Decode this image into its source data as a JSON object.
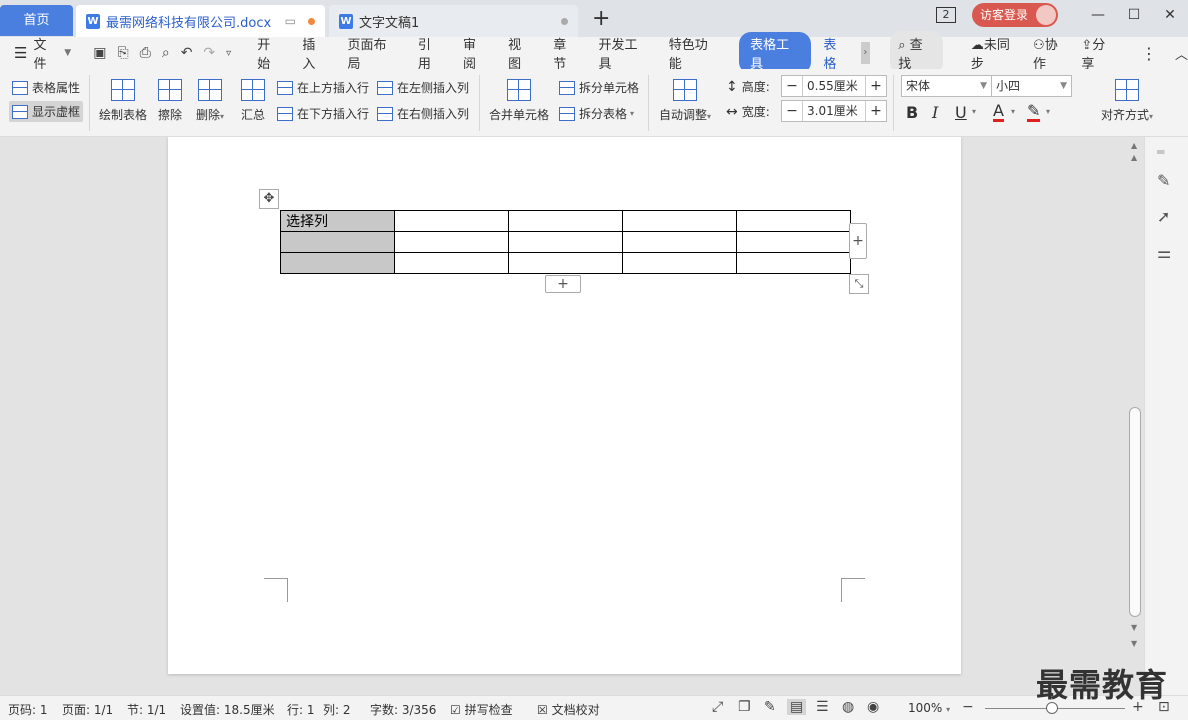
{
  "tabs": {
    "home": "首页",
    "active_doc": "最需网络科技有限公司.docx",
    "second_doc": "文字文稿1",
    "new_tab": "+"
  },
  "titlebar": {
    "badge": "2",
    "login": "访客登录",
    "minimize": "—",
    "maximize": "☐",
    "close": "✕"
  },
  "menubar": {
    "file": "文件",
    "items": [
      "开始",
      "插入",
      "页面布局",
      "引用",
      "审阅",
      "视图",
      "章节",
      "开发工具",
      "特色功能"
    ],
    "active": "表格工具",
    "next": "表格",
    "search": "查找",
    "sync": "未同步",
    "collab": "协作",
    "share": "分享"
  },
  "ribbon": {
    "table_props": "表格属性",
    "show_grid": "显示虚框",
    "draw_table": "绘制表格",
    "erase": "擦除",
    "delete": "删除",
    "summary": "汇总",
    "insert_above": "在上方插入行",
    "insert_below": "在下方插入行",
    "insert_left": "在左侧插入列",
    "insert_right": "在右侧插入列",
    "merge_cells": "合并单元格",
    "split_cells": "拆分单元格",
    "split_table": "拆分表格",
    "auto_adjust": "自动调整",
    "height_label": "高度:",
    "height_value": "0.55厘米",
    "width_label": "宽度:",
    "width_value": "3.01厘米",
    "font_name": "宋体",
    "font_size": "小四",
    "align": "对齐方式"
  },
  "document": {
    "table_rows": [
      [
        "选择列",
        "",
        "",
        "",
        ""
      ],
      [
        "",
        "",
        "",
        "",
        ""
      ],
      [
        "",
        "",
        "",
        "",
        ""
      ]
    ]
  },
  "statusbar": {
    "page_num": "页码: 1",
    "pages": "页面: 1/1",
    "section": "节: 1/1",
    "setting": "设置值: 18.5厘米",
    "row": "行: 1",
    "col": "列: 2",
    "words": "字数: 3/356",
    "spell": "拼写检查",
    "proof": "文档校对",
    "zoom": "100%"
  },
  "watermark": "最需教育",
  "colors": {
    "accent": "#4a7fe0",
    "login": "#d9584f",
    "selection": "#c8c8c8"
  }
}
